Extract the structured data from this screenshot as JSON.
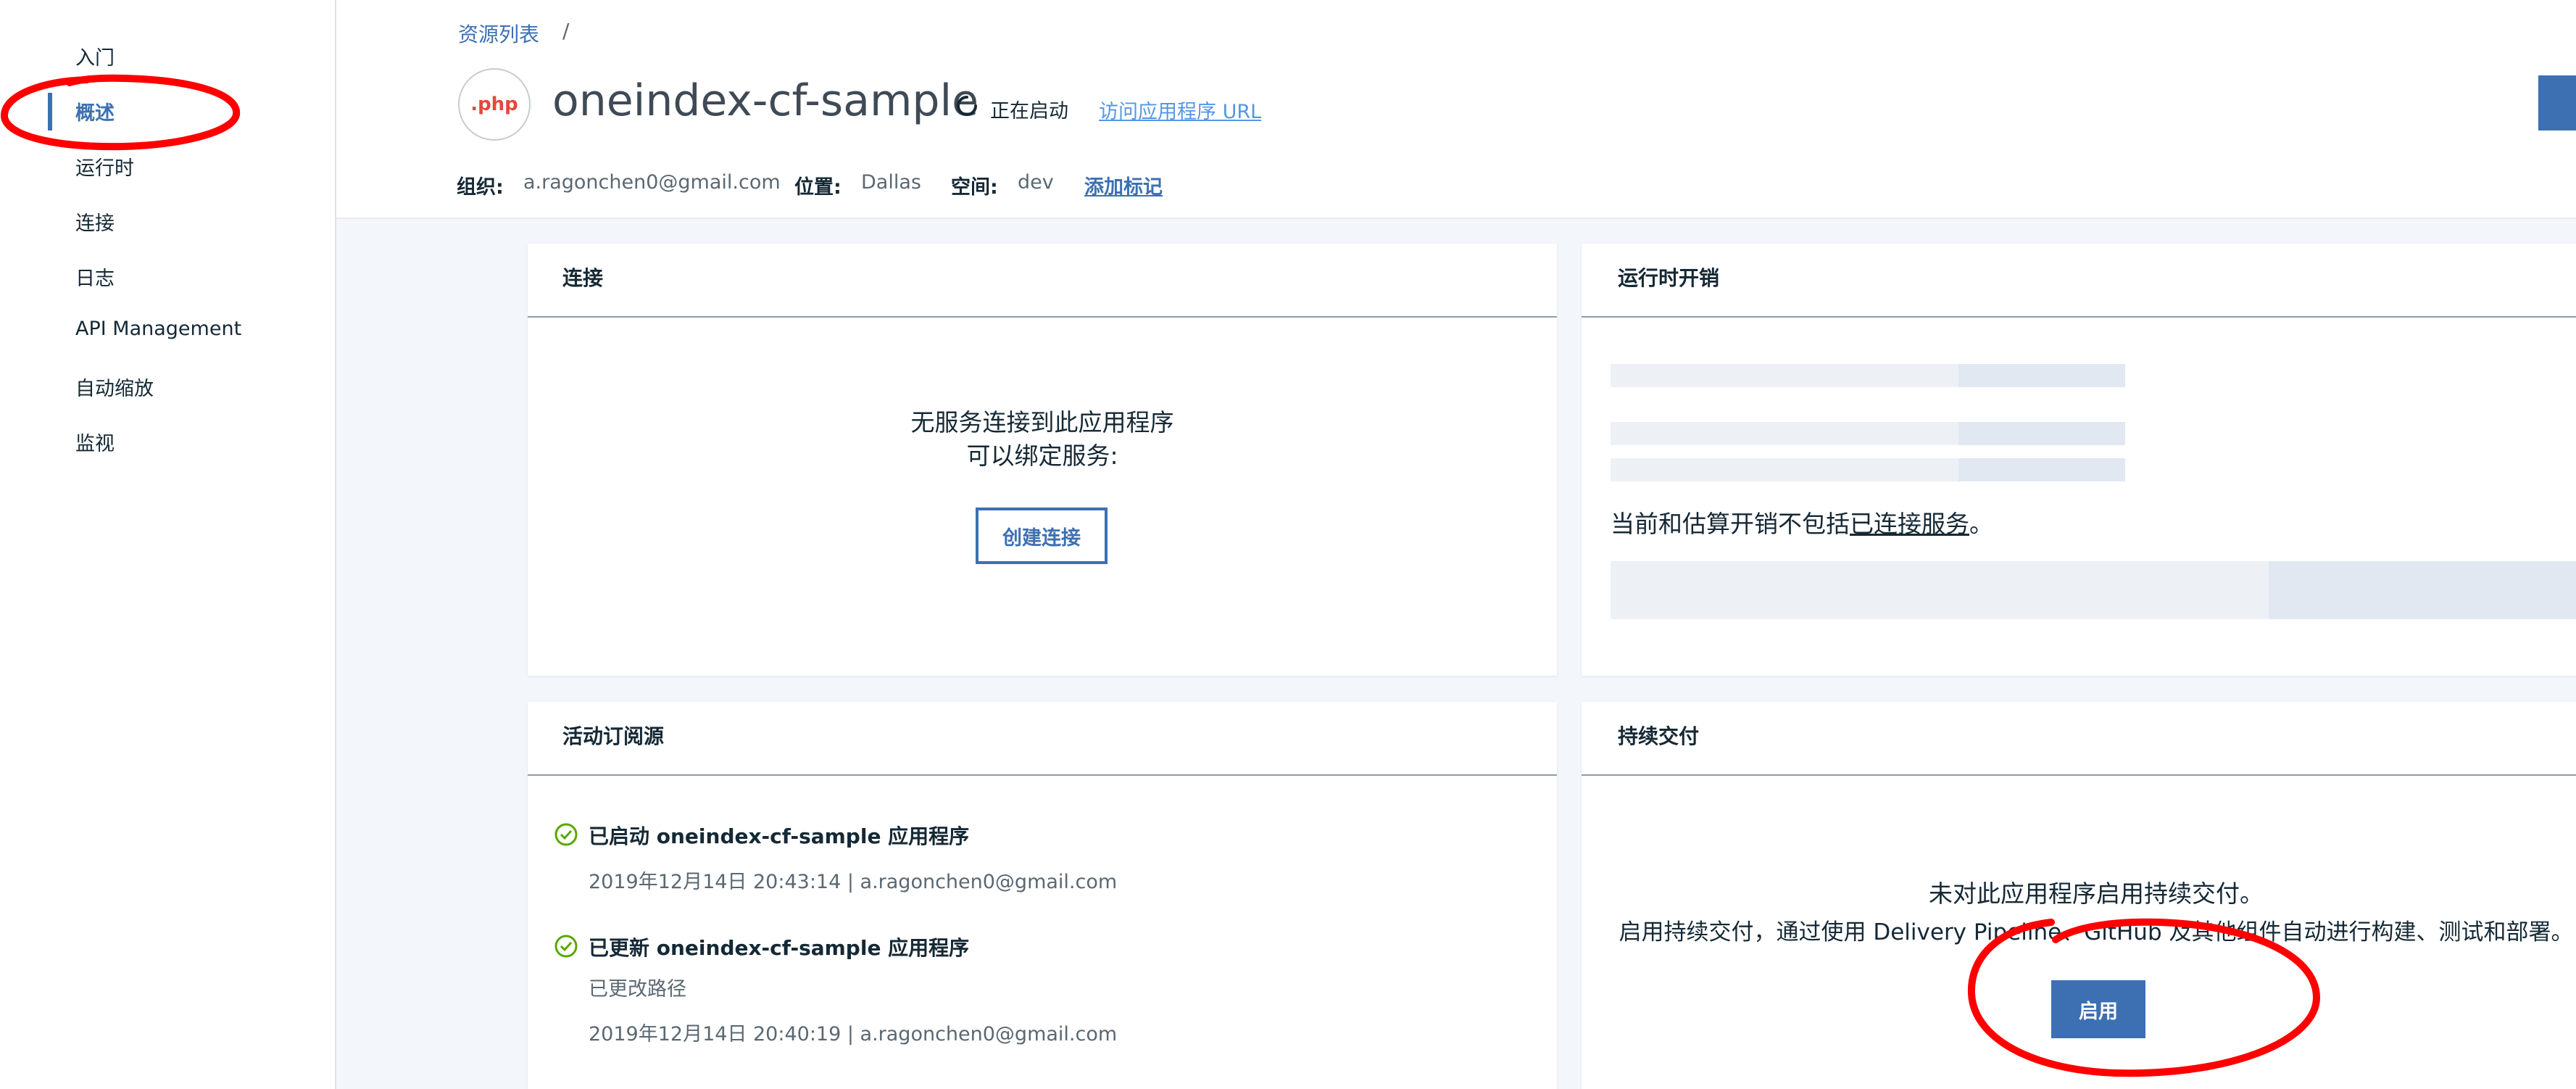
{
  "sidebar": {
    "items": [
      {
        "label": "入门"
      },
      {
        "label": "概述",
        "active": true
      },
      {
        "label": "运行时"
      },
      {
        "label": "连接"
      },
      {
        "label": "日志"
      },
      {
        "label": "API Management"
      },
      {
        "label": "自动缩放"
      },
      {
        "label": "监视"
      }
    ]
  },
  "header": {
    "breadcrumb": "资源列表",
    "breadcrumb_sep": "/",
    "logo_text": ".php",
    "app_name": "oneindex-cf-sample",
    "status": "正在启动",
    "visit_url_label": "访问应用程序 URL",
    "org_label": "组织:",
    "org_value": "a.ragonchen0@gmail.com",
    "location_label": "位置:",
    "location_value": "Dallas",
    "space_label": "空间:",
    "space_value": "dev",
    "add_tag_label": "添加标记"
  },
  "connections_card": {
    "title": "连接",
    "line1": "无服务连接到此应用程序",
    "line2": "可以绑定服务:",
    "button": "创建连接"
  },
  "runtime_cost_card": {
    "title": "运行时开销",
    "note_prefix": "当前和估算开销不包括",
    "note_link": "已连接服务",
    "note_suffix": "。"
  },
  "activity_card": {
    "title": "活动订阅源",
    "events": [
      {
        "title": "已启动 oneindex-cf-sample 应用程序",
        "detail": "",
        "meta": "2019年12月14日 20:43:14 | a.ragonchen0@gmail.com"
      },
      {
        "title": "已更新 oneindex-cf-sample 应用程序",
        "detail": "已更改路径",
        "meta": "2019年12月14日 20:40:19 | a.ragonchen0@gmail.com"
      }
    ]
  },
  "delivery_card": {
    "title": "持续交付",
    "line1": "未对此应用程序启用持续交付。",
    "line2": "启用持续交付，通过使用 Delivery Pipeline、GitHub 及其他组件自动进行构建、测试和部署。",
    "button": "启用"
  },
  "colors": {
    "accent": "#3d70b2",
    "link": "#5596e6",
    "success": "#5aa700",
    "annotation": "#ff0000"
  },
  "icons": {
    "status": "spinner-icon",
    "activity": "check-circle-icon"
  }
}
